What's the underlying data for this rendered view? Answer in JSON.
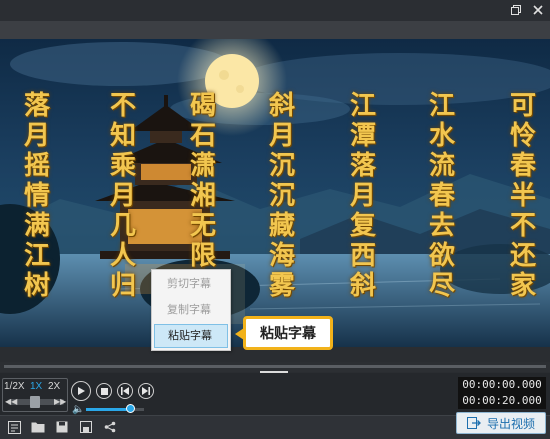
{
  "window": {
    "restore_icon": "restore-icon",
    "close_icon": "close-icon"
  },
  "subtitles": {
    "columns": [
      "可怜春半不还家",
      "江水流春去欲尽",
      "江潭落月复西斜",
      "斜月沉沉藏海雾",
      "碣石潇湘无限路",
      "不知乘月几人归",
      "落月摇情满江树"
    ]
  },
  "context_menu": {
    "items": [
      {
        "label": "剪切字幕",
        "enabled": false
      },
      {
        "label": "复制字幕",
        "enabled": false
      },
      {
        "label": "粘贴字幕",
        "enabled": true
      }
    ]
  },
  "tooltip": {
    "text": "粘贴字幕"
  },
  "player": {
    "speeds": [
      "1/2X",
      "1X",
      "2X"
    ],
    "active_speed": "1X",
    "current_time": "00:00:00.000",
    "total_time": "00:00:20.000",
    "progress": 0.0,
    "volume": 0.75
  },
  "bottom_toolbar": {
    "icons": [
      "subtitle-icon",
      "folder-open-icon",
      "save-icon",
      "save-as-icon",
      "share-icon"
    ],
    "export_label": "导出视频"
  },
  "colors": {
    "accent": "#2aa7e8",
    "subtitle": "#f2c64f",
    "tooltip_border": "#f2b21a"
  }
}
